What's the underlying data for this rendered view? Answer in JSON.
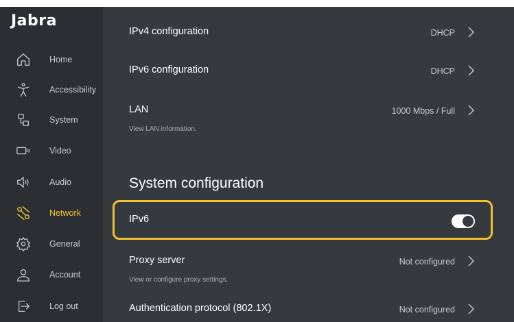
{
  "brand": "Jabra",
  "sidebar": {
    "items": [
      {
        "label": "Home",
        "icon": "home-icon"
      },
      {
        "label": "Accessibility",
        "icon": "accessibility-icon"
      },
      {
        "label": "System",
        "icon": "system-icon"
      },
      {
        "label": "Video",
        "icon": "video-icon"
      },
      {
        "label": "Audio",
        "icon": "audio-icon"
      },
      {
        "label": "Network",
        "icon": "network-icon",
        "active": true
      },
      {
        "label": "General",
        "icon": "gear-icon"
      },
      {
        "label": "Account",
        "icon": "account-icon"
      },
      {
        "label": "Log out",
        "icon": "logout-icon"
      }
    ]
  },
  "main": {
    "ipv4": {
      "title": "IPv4 configuration",
      "value": "DHCP"
    },
    "ipv6cfg": {
      "title": "IPv6 configuration",
      "value": "DHCP"
    },
    "lan": {
      "title": "LAN",
      "value": "1000 Mbps / Full",
      "sub": "View LAN information."
    },
    "section_title": "System configuration",
    "ipv6": {
      "title": "IPv6",
      "enabled": true
    },
    "proxy": {
      "title": "Proxy server",
      "value": "Not configured",
      "sub": "View or configure proxy settings."
    },
    "auth": {
      "title": "Authentication protocol (802.1X)",
      "value": "Not configured"
    }
  },
  "colors": {
    "accent": "#f2c12e",
    "sidebar_bg": "#2b2f34",
    "content_bg": "#353a3f",
    "text": "#ffffff",
    "muted": "#c9cdd1"
  }
}
